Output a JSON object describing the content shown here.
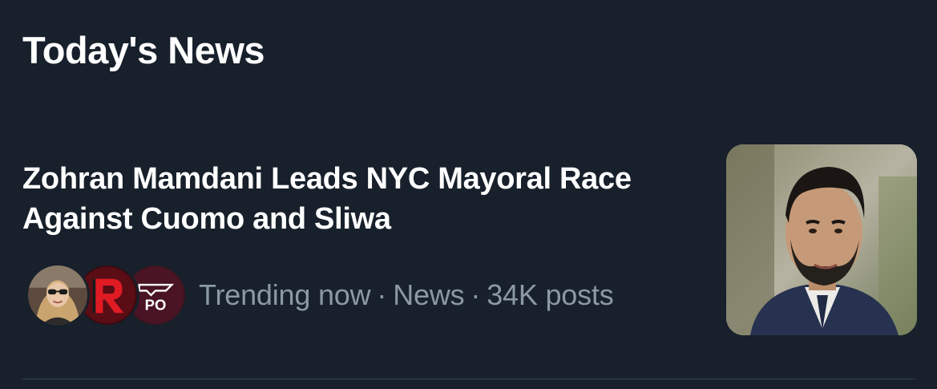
{
  "section": {
    "title": "Today's News"
  },
  "story": {
    "headline": "Zohran Mamdani Leads NYC Mayoral Race Against Cuomo and Sliwa",
    "meta": {
      "status": "Trending now",
      "category": "News",
      "posts": "34K posts",
      "separator": "·"
    },
    "avatars": [
      {
        "icon": "woman-sunglasses-avatar"
      },
      {
        "icon": "red-r-logo-avatar"
      },
      {
        "icon": "po-logo-avatar",
        "logo_text": "PO"
      }
    ],
    "thumbnail": {
      "icon": "person-portrait-thumbnail"
    }
  },
  "colors": {
    "background": "#17202b",
    "text_primary": "#ffffff",
    "text_secondary": "#8b98a5",
    "divider": "#38444d"
  }
}
